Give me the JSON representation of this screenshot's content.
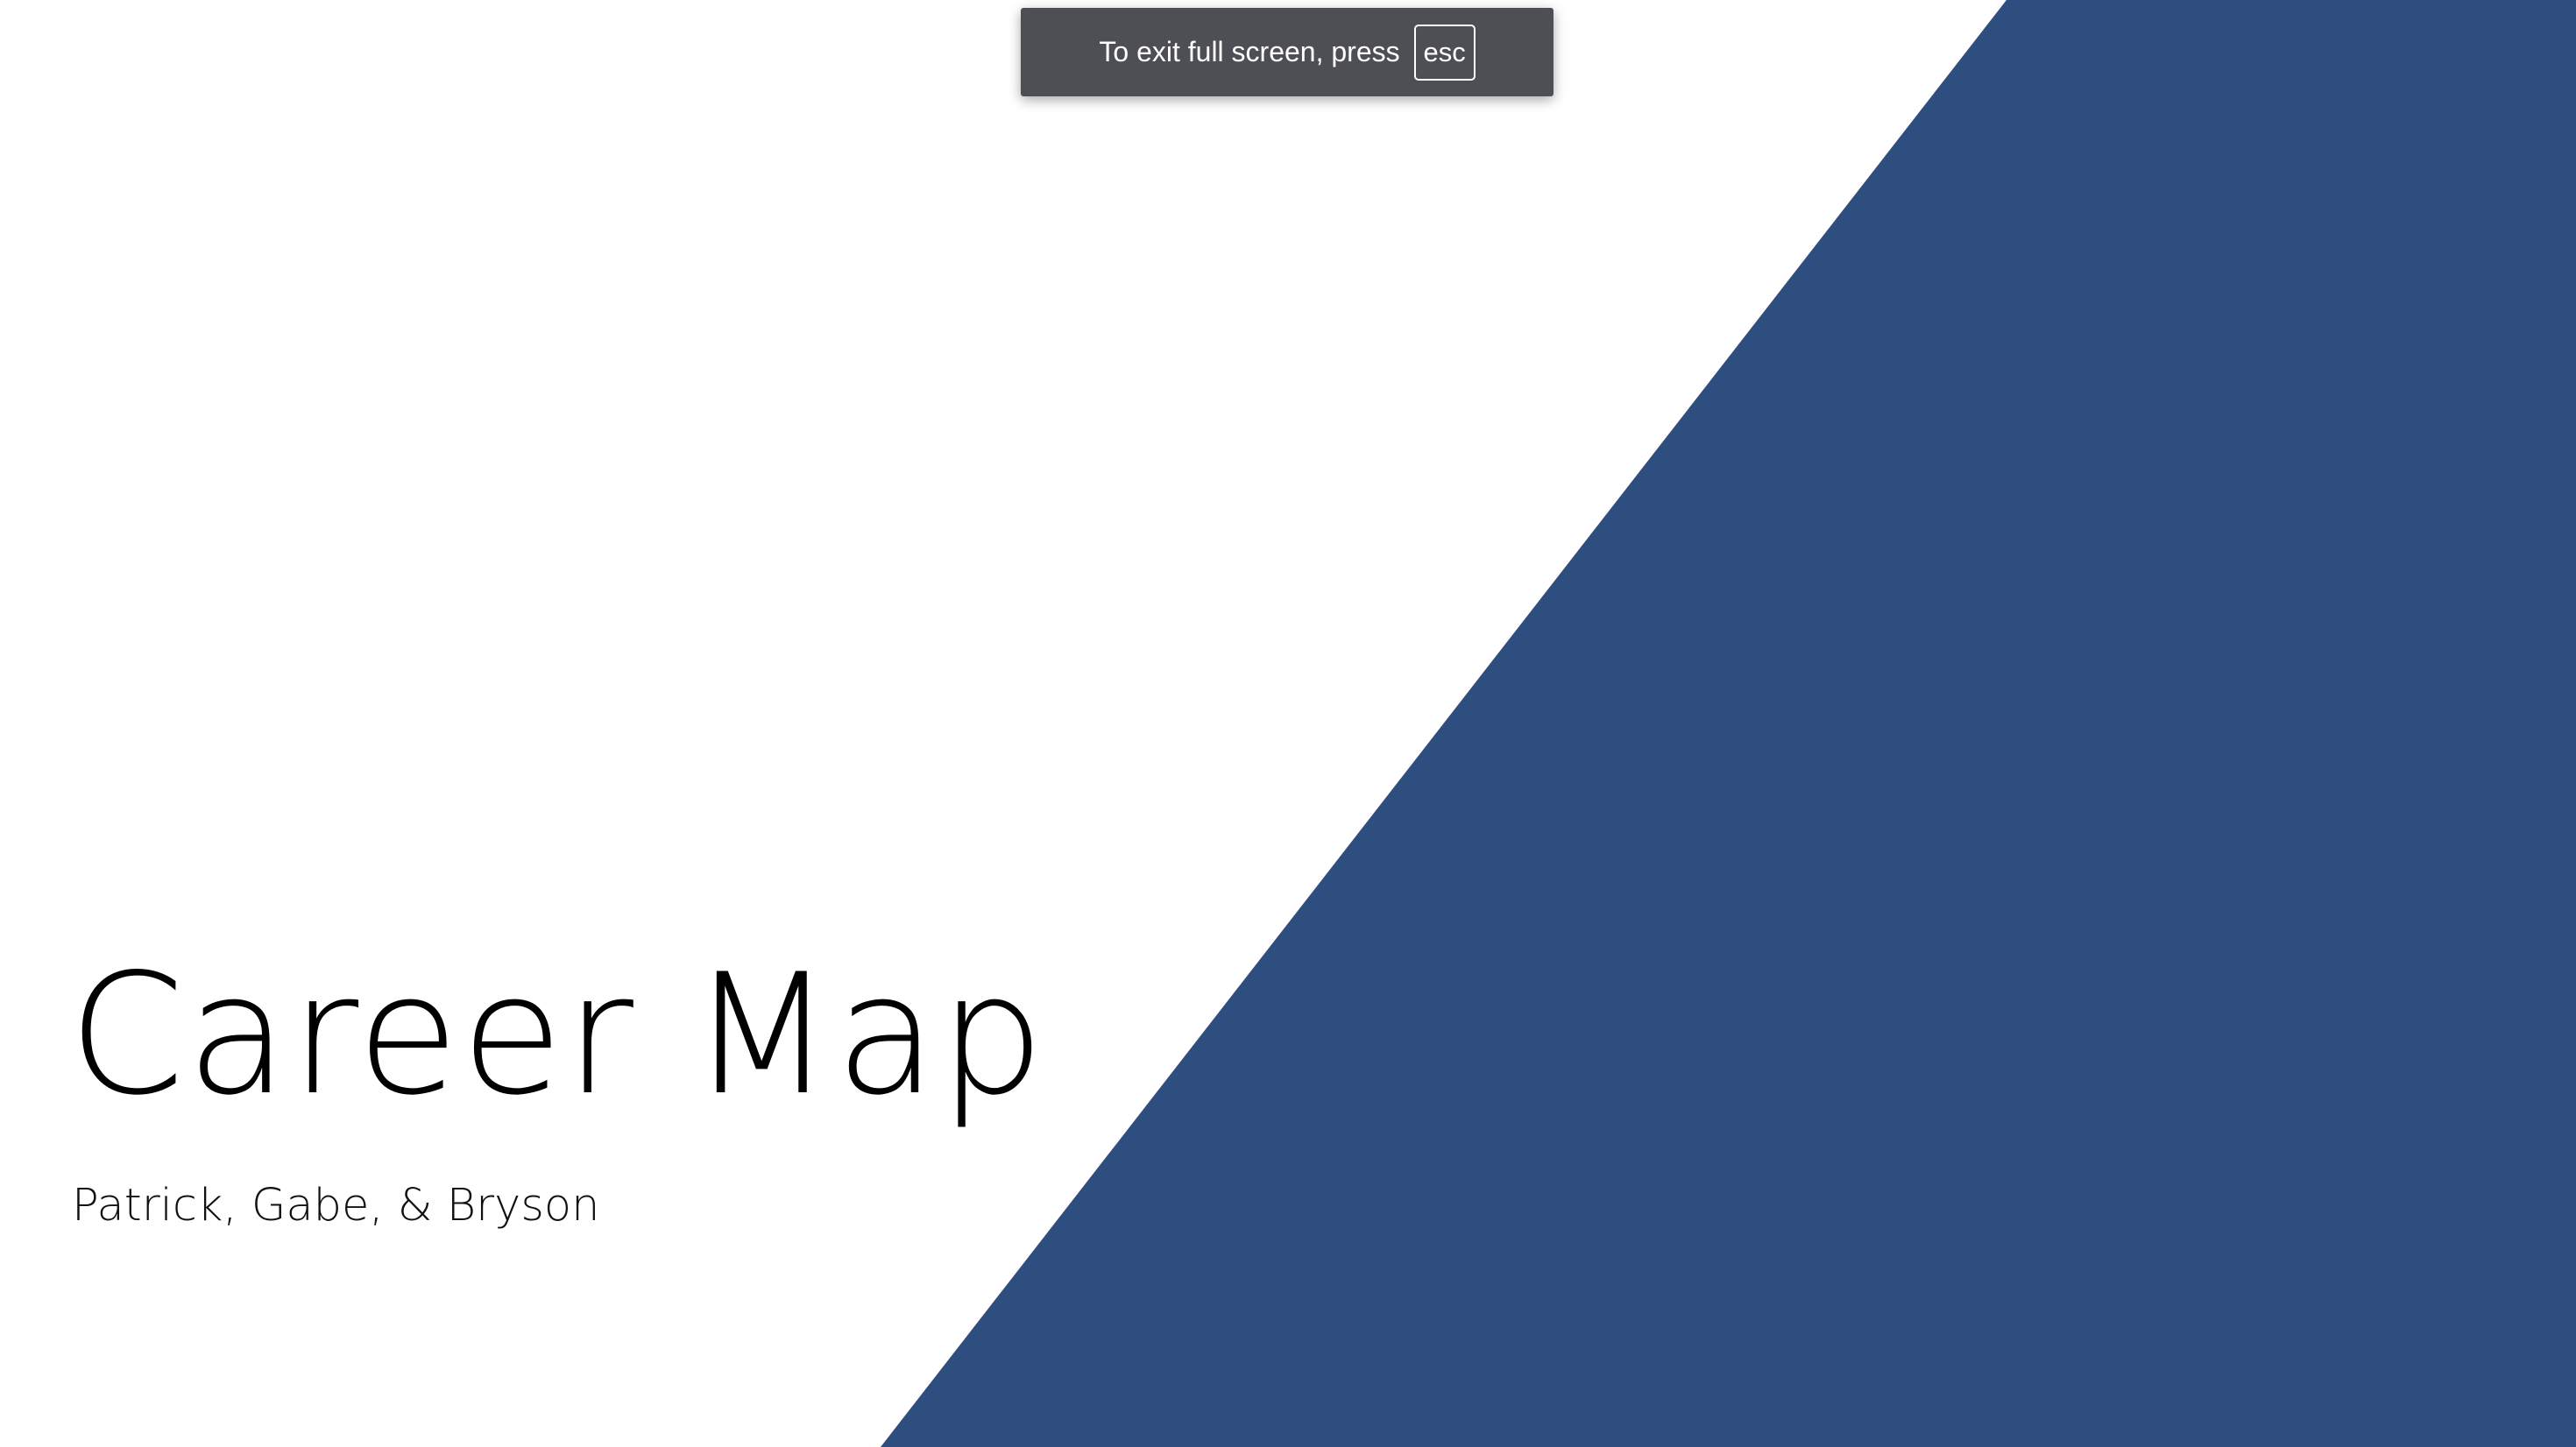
{
  "slide": {
    "title": "Career Map",
    "subtitle": "Patrick, Gabe, & Bryson",
    "accent_color": "#2d4e7e",
    "background_color": "#ffffff"
  },
  "fullscreen_banner": {
    "message": "To exit full screen, press",
    "key_label": "esc"
  }
}
